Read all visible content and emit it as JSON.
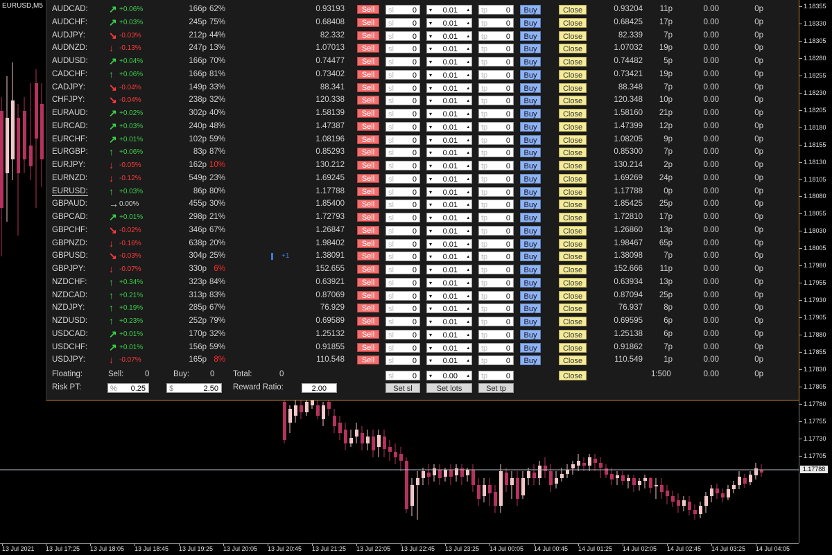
{
  "chart": {
    "symbol_label": "EURUSD,M5",
    "current_price_tag": "1.17788",
    "y_ticks": [
      "1.18355",
      "1.18330",
      "1.18305",
      "1.18280",
      "1.18255",
      "1.18230",
      "1.18205",
      "1.18180",
      "1.18155",
      "1.18130",
      "1.18105",
      "1.18080",
      "1.18055",
      "1.18030",
      "1.18005",
      "1.17980",
      "1.17955",
      "1.17930",
      "1.17905",
      "1.17880",
      "1.17855",
      "1.17830",
      "1.17805",
      "1.17780",
      "1.17755",
      "1.17730",
      "1.17705"
    ],
    "x_ticks": [
      "13 Jul 2021",
      "13 Jul 17:25",
      "13 Jul 18:05",
      "13 Jul 18:45",
      "13 Jul 19:25",
      "13 Jul 20:05",
      "13 Jul 20:45",
      "13 Jul 21:25",
      "13 Jul 22:05",
      "13 Jul 22:45",
      "13 Jul 23:25",
      "14 Jul 00:05",
      "14 Jul 00:45",
      "14 Jul 01:25",
      "14 Jul 02:05",
      "14 Jul 02:45",
      "14 Jul 03:25",
      "14 Jul 04:05"
    ],
    "colors": {
      "bull": "#f2c7c7",
      "bear": "#b5325e",
      "up_tick": "#29c73a"
    }
  },
  "panel": {
    "rows": [
      {
        "sym": "AUDCAD:",
        "dir": "up-right",
        "chg": "+0.06%",
        "chg_color": "up",
        "pips": "166p",
        "pct": "62%",
        "pct_red": false,
        "bid": "0.93193",
        "sl_ph": "sl",
        "sl_v": "0",
        "lots": "0.01",
        "tp_ph": "tp",
        "tp_v": "0",
        "ask": "0.93204",
        "spread": "11p",
        "profit": "0.00",
        "ppips": "0p"
      },
      {
        "sym": "AUDCHF:",
        "dir": "up-right",
        "chg": "+0.03%",
        "chg_color": "up",
        "pips": "245p",
        "pct": "75%",
        "pct_red": false,
        "bid": "0.68408",
        "sl_ph": "sl",
        "sl_v": "0",
        "lots": "0.01",
        "tp_ph": "tp",
        "tp_v": "0",
        "ask": "0.68425",
        "spread": "17p",
        "profit": "0.00",
        "ppips": "0p"
      },
      {
        "sym": "AUDJPY:",
        "dir": "down-right",
        "chg": "-0.03%",
        "chg_color": "down",
        "pips": "212p",
        "pct": "44%",
        "pct_red": false,
        "bid": "82.332",
        "sl_ph": "sl",
        "sl_v": "0",
        "lots": "0.01",
        "tp_ph": "tp",
        "tp_v": "0",
        "ask": "82.339",
        "spread": "7p",
        "profit": "0.00",
        "ppips": "0p"
      },
      {
        "sym": "AUDNZD:",
        "dir": "down",
        "chg": "-0.13%",
        "chg_color": "down",
        "pips": "247p",
        "pct": "13%",
        "pct_red": false,
        "bid": "1.07013",
        "sl_ph": "sl",
        "sl_v": "0",
        "lots": "0.01",
        "tp_ph": "tp",
        "tp_v": "0",
        "ask": "1.07032",
        "spread": "19p",
        "profit": "0.00",
        "ppips": "0p"
      },
      {
        "sym": "AUDUSD:",
        "dir": "up-right",
        "chg": "+0.04%",
        "chg_color": "up",
        "pips": "166p",
        "pct": "70%",
        "pct_red": false,
        "bid": "0.74477",
        "sl_ph": "sl",
        "sl_v": "0",
        "lots": "0.01",
        "tp_ph": "tp",
        "tp_v": "0",
        "ask": "0.74482",
        "spread": "5p",
        "profit": "0.00",
        "ppips": "0p"
      },
      {
        "sym": "CADCHF:",
        "dir": "up",
        "chg": "+0.06%",
        "chg_color": "up",
        "pips": "166p",
        "pct": "81%",
        "pct_red": false,
        "bid": "0.73402",
        "sl_ph": "sl",
        "sl_v": "0",
        "lots": "0.01",
        "tp_ph": "tp",
        "tp_v": "0",
        "ask": "0.73421",
        "spread": "19p",
        "profit": "0.00",
        "ppips": "0p"
      },
      {
        "sym": "CADJPY:",
        "dir": "down-right",
        "chg": "-0.04%",
        "chg_color": "down",
        "pips": "149p",
        "pct": "33%",
        "pct_red": false,
        "bid": "88.341",
        "sl_ph": "sl",
        "sl_v": "0",
        "lots": "0.01",
        "tp_ph": "tp",
        "tp_v": "0",
        "ask": "88.348",
        "spread": "7p",
        "profit": "0.00",
        "ppips": "0p"
      },
      {
        "sym": "CHFJPY:",
        "dir": "down-right",
        "chg": "-0.04%",
        "chg_color": "down",
        "pips": "238p",
        "pct": "32%",
        "pct_red": false,
        "bid": "120.338",
        "sl_ph": "sl",
        "sl_v": "0",
        "lots": "0.01",
        "tp_ph": "tp",
        "tp_v": "0",
        "ask": "120.348",
        "spread": "10p",
        "profit": "0.00",
        "ppips": "0p"
      },
      {
        "sym": "EURAUD:",
        "dir": "up-right",
        "chg": "+0.02%",
        "chg_color": "up",
        "pips": "302p",
        "pct": "40%",
        "pct_red": false,
        "bid": "1.58139",
        "sl_ph": "sl",
        "sl_v": "0",
        "lots": "0.01",
        "tp_ph": "tp",
        "tp_v": "0",
        "ask": "1.58160",
        "spread": "21p",
        "profit": "0.00",
        "ppips": "0p"
      },
      {
        "sym": "EURCAD:",
        "dir": "up-right",
        "chg": "+0.03%",
        "chg_color": "up",
        "pips": "240p",
        "pct": "48%",
        "pct_red": false,
        "bid": "1.47387",
        "sl_ph": "sl",
        "sl_v": "0",
        "lots": "0.01",
        "tp_ph": "tp",
        "tp_v": "0",
        "ask": "1.47399",
        "spread": "12p",
        "profit": "0.00",
        "ppips": "0p"
      },
      {
        "sym": "EURCHF:",
        "dir": "up-right",
        "chg": "+0.01%",
        "chg_color": "up",
        "pips": "102p",
        "pct": "59%",
        "pct_red": false,
        "bid": "1.08196",
        "sl_ph": "sl",
        "sl_v": "0",
        "lots": "0.01",
        "tp_ph": "tp",
        "tp_v": "0",
        "ask": "1.08205",
        "spread": "9p",
        "profit": "0.00",
        "ppips": "0p"
      },
      {
        "sym": "EURGBP:",
        "dir": "up",
        "chg": "+0.06%",
        "chg_color": "up",
        "pips": "83p",
        "pct": "87%",
        "pct_red": false,
        "bid": "0.85293",
        "sl_ph": "sl",
        "sl_v": "0",
        "lots": "0.01",
        "tp_ph": "tp",
        "tp_v": "0",
        "ask": "0.85300",
        "spread": "7p",
        "profit": "0.00",
        "ppips": "0p"
      },
      {
        "sym": "EURJPY:",
        "dir": "down",
        "chg": "-0.05%",
        "chg_color": "down",
        "pips": "162p",
        "pct": "10%",
        "pct_red": true,
        "bid": "130.212",
        "sl_ph": "sl",
        "sl_v": "0",
        "lots": "0.01",
        "tp_ph": "tp",
        "tp_v": "0",
        "ask": "130.214",
        "spread": "2p",
        "profit": "0.00",
        "ppips": "0p"
      },
      {
        "sym": "EURNZD:",
        "dir": "down",
        "chg": "-0.12%",
        "chg_color": "down",
        "pips": "549p",
        "pct": "23%",
        "pct_red": false,
        "bid": "1.69245",
        "sl_ph": "sl",
        "sl_v": "0",
        "lots": "0.01",
        "tp_ph": "tp",
        "tp_v": "0",
        "ask": "1.69269",
        "spread": "24p",
        "profit": "0.00",
        "ppips": "0p"
      },
      {
        "sym": "EURUSD:",
        "dir": "up",
        "chg": "+0.03%",
        "chg_color": "up",
        "pips": "86p",
        "pct": "80%",
        "pct_red": false,
        "bid": "1.17788",
        "sl_ph": "sl",
        "sl_v": "0",
        "lots": "0.01",
        "tp_ph": "tp",
        "tp_v": "0",
        "ask": "1.17788",
        "spread": "0p",
        "profit": "0.00",
        "ppips": "0p",
        "active": true
      },
      {
        "sym": "GBPAUD:",
        "dir": "right",
        "chg": "0.00%",
        "chg_color": "flat",
        "pips": "455p",
        "pct": "30%",
        "pct_red": false,
        "bid": "1.85400",
        "sl_ph": "sl",
        "sl_v": "0",
        "lots": "0.01",
        "tp_ph": "tp",
        "tp_v": "0",
        "ask": "1.85425",
        "spread": "25p",
        "profit": "0.00",
        "ppips": "0p"
      },
      {
        "sym": "GBPCAD:",
        "dir": "up-right",
        "chg": "+0.01%",
        "chg_color": "up",
        "pips": "298p",
        "pct": "21%",
        "pct_red": false,
        "bid": "1.72793",
        "sl_ph": "sl",
        "sl_v": "0",
        "lots": "0.01",
        "tp_ph": "tp",
        "tp_v": "0",
        "ask": "1.72810",
        "spread": "17p",
        "profit": "0.00",
        "ppips": "0p"
      },
      {
        "sym": "GBPCHF:",
        "dir": "down-right",
        "chg": "-0.02%",
        "chg_color": "down",
        "pips": "346p",
        "pct": "67%",
        "pct_red": false,
        "bid": "1.26847",
        "sl_ph": "sl",
        "sl_v": "0",
        "lots": "0.01",
        "tp_ph": "tp",
        "tp_v": "0",
        "ask": "1.26860",
        "spread": "13p",
        "profit": "0.00",
        "ppips": "0p"
      },
      {
        "sym": "GBPNZD:",
        "dir": "down",
        "chg": "-0.16%",
        "chg_color": "down",
        "pips": "638p",
        "pct": "20%",
        "pct_red": false,
        "bid": "1.98402",
        "sl_ph": "sl",
        "sl_v": "0",
        "lots": "0.01",
        "tp_ph": "tp",
        "tp_v": "0",
        "ask": "1.98467",
        "spread": "65p",
        "profit": "0.00",
        "ppips": "0p"
      },
      {
        "sym": "GBPUSD:",
        "dir": "down-right",
        "chg": "-0.03%",
        "chg_color": "down",
        "pips": "304p",
        "pct": "25%",
        "pct_red": false,
        "bid": "1.38091",
        "sl_ph": "sl",
        "sl_v": "0",
        "lots": "0.01",
        "tp_ph": "tp",
        "tp_v": "0",
        "ask": "1.38098",
        "spread": "7p",
        "profit": "0.00",
        "ppips": "0p",
        "gauge": "+1"
      },
      {
        "sym": "GBPJPY:",
        "dir": "down",
        "chg": "-0.07%",
        "chg_color": "down",
        "pips": "330p",
        "pct": "6%",
        "pct_red": true,
        "bid": "152.655",
        "sl_ph": "sl",
        "sl_v": "0",
        "lots": "0.01",
        "tp_ph": "tp",
        "tp_v": "0",
        "ask": "152.666",
        "spread": "11p",
        "profit": "0.00",
        "ppips": "0p"
      },
      {
        "sym": "NZDCHF:",
        "dir": "up",
        "chg": "+0.34%",
        "chg_color": "up",
        "pips": "323p",
        "pct": "84%",
        "pct_red": false,
        "bid": "0.63921",
        "sl_ph": "sl",
        "sl_v": "0",
        "lots": "0.01",
        "tp_ph": "tp",
        "tp_v": "0",
        "ask": "0.63934",
        "spread": "13p",
        "profit": "0.00",
        "ppips": "0p"
      },
      {
        "sym": "NZDCAD:",
        "dir": "up",
        "chg": "+0.21%",
        "chg_color": "up",
        "pips": "313p",
        "pct": "83%",
        "pct_red": false,
        "bid": "0.87069",
        "sl_ph": "sl",
        "sl_v": "0",
        "lots": "0.01",
        "tp_ph": "tp",
        "tp_v": "0",
        "ask": "0.87094",
        "spread": "25p",
        "profit": "0.00",
        "ppips": "0p"
      },
      {
        "sym": "NZDJPY:",
        "dir": "up",
        "chg": "+0.19%",
        "chg_color": "up",
        "pips": "285p",
        "pct": "67%",
        "pct_red": false,
        "bid": "76.929",
        "sl_ph": "sl",
        "sl_v": "0",
        "lots": "0.01",
        "tp_ph": "tp",
        "tp_v": "0",
        "ask": "76.937",
        "spread": "8p",
        "profit": "0.00",
        "ppips": "0p"
      },
      {
        "sym": "NZDUSD:",
        "dir": "up",
        "chg": "+0.23%",
        "chg_color": "up",
        "pips": "252p",
        "pct": "79%",
        "pct_red": false,
        "bid": "0.69589",
        "sl_ph": "sl",
        "sl_v": "0",
        "lots": "0.01",
        "tp_ph": "tp",
        "tp_v": "0",
        "ask": "0.69595",
        "spread": "6p",
        "profit": "0.00",
        "ppips": "0p"
      },
      {
        "sym": "USDCAD:",
        "dir": "up-right",
        "chg": "+0.01%",
        "chg_color": "up",
        "pips": "170p",
        "pct": "32%",
        "pct_red": false,
        "bid": "1.25132",
        "sl_ph": "sl",
        "sl_v": "0",
        "lots": "0.01",
        "tp_ph": "tp",
        "tp_v": "0",
        "ask": "1.25138",
        "spread": "6p",
        "profit": "0.00",
        "ppips": "0p"
      },
      {
        "sym": "USDCHF:",
        "dir": "up-right",
        "chg": "+0.01%",
        "chg_color": "up",
        "pips": "156p",
        "pct": "59%",
        "pct_red": false,
        "bid": "0.91855",
        "sl_ph": "sl",
        "sl_v": "0",
        "lots": "0.01",
        "tp_ph": "tp",
        "tp_v": "0",
        "ask": "0.91862",
        "spread": "7p",
        "profit": "0.00",
        "ppips": "0p"
      },
      {
        "sym": "USDJPY:",
        "dir": "down",
        "chg": "-0.07%",
        "chg_color": "down",
        "pips": "165p",
        "pct": "8%",
        "pct_red": true,
        "bid": "110.548",
        "sl_ph": "sl",
        "sl_v": "0",
        "lots": "0.01",
        "tp_ph": "tp",
        "tp_v": "0",
        "ask": "110.549",
        "spread": "1p",
        "profit": "0.00",
        "ppips": "0p"
      }
    ],
    "buttons": {
      "sell": "Sell",
      "buy": "Buy",
      "close": "Close"
    },
    "footer": {
      "floating_label": "Floating:",
      "sell_label": "Sell:",
      "sell_value": "0",
      "buy_label": "Buy:",
      "buy_value": "0",
      "total_label": "Total:",
      "total_value": "0",
      "sl_ph": "sl",
      "sl_value": "0",
      "lots_value": "0.00",
      "tp_ph": "tp",
      "tp_value": "0",
      "close_all": "Close",
      "leverage": "1:500",
      "profit": "0.00",
      "pips": "0p",
      "risk_label": "Risk PT:",
      "risk_unit": "%",
      "risk_value": "0.25",
      "money_unit": "$",
      "money_value": "2.50",
      "reward_label": "Reward Ratio:",
      "reward_value": "2.00",
      "set_sl": "Set sl",
      "set_lots": "Set lots",
      "set_tp": "Set tp"
    }
  }
}
